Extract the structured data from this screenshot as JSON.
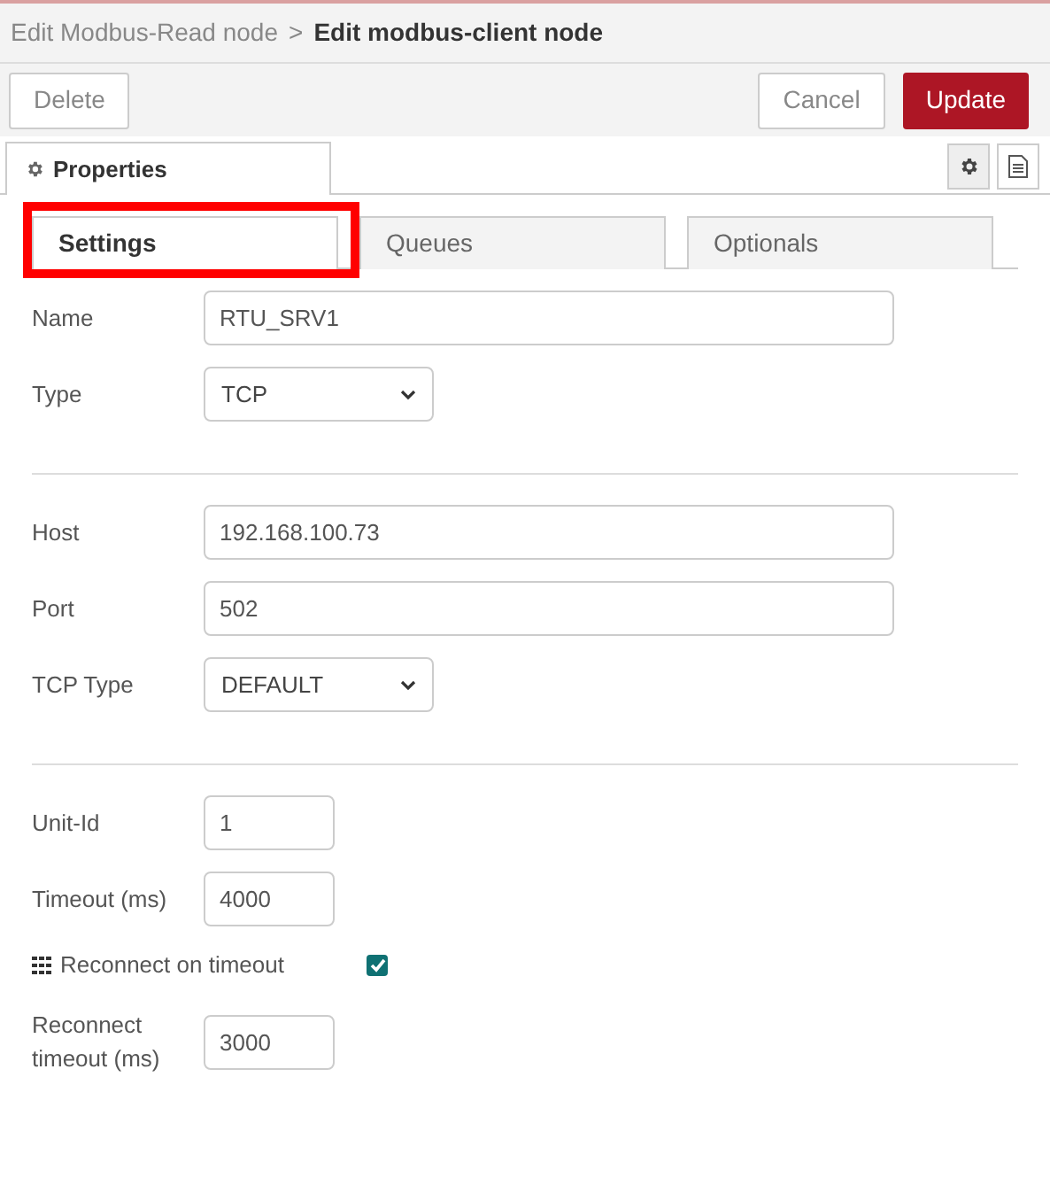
{
  "breadcrumb": {
    "parent": "Edit Modbus-Read node",
    "separator": ">",
    "current": "Edit modbus-client node"
  },
  "toolbar": {
    "delete": "Delete",
    "cancel": "Cancel",
    "update": "Update"
  },
  "panel_tab": {
    "label": "Properties",
    "selected": true
  },
  "tabs": [
    {
      "label": "Settings",
      "selected": true,
      "highlighted": true
    },
    {
      "label": "Queues",
      "selected": false,
      "highlighted": false
    },
    {
      "label": "Optionals",
      "selected": false,
      "highlighted": false
    }
  ],
  "rows": [
    {
      "kind": "text",
      "label": "Name",
      "value": "RTU_SRV1"
    },
    {
      "kind": "select",
      "label": "Type",
      "value": "TCP"
    },
    {
      "kind": "divider"
    },
    {
      "kind": "text",
      "label": "Host",
      "value": "192.168.100.73"
    },
    {
      "kind": "text",
      "label": "Port",
      "value": "502"
    },
    {
      "kind": "select",
      "label": "TCP Type",
      "value": "DEFAULT"
    },
    {
      "kind": "divider"
    },
    {
      "kind": "number",
      "label": "Unit-Id",
      "value": "1"
    },
    {
      "kind": "number",
      "label": "Timeout (ms)",
      "value": "4000"
    },
    {
      "kind": "checkbox",
      "label": "Reconnect on timeout",
      "checked": true
    },
    {
      "kind": "number",
      "label": "Reconnect timeout (ms)",
      "value": "3000"
    }
  ]
}
